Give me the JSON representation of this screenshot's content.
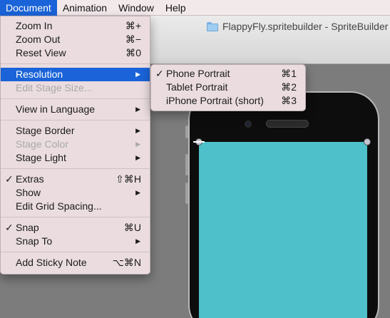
{
  "menubar": {
    "items": [
      "Document",
      "Animation",
      "Window",
      "Help"
    ]
  },
  "window": {
    "title": "FlappyFly.spritebuilder - SpriteBuilder"
  },
  "colors": {
    "highlight": "#1a63d8",
    "menu_bg": "#eadcdf",
    "stage_bg": "#7c7c7c",
    "phone_screen": "#4ec0ca"
  },
  "document_menu": {
    "zoom_in": {
      "label": "Zoom In",
      "shortcut": "⌘+"
    },
    "zoom_out": {
      "label": "Zoom Out",
      "shortcut": "⌘−"
    },
    "reset_view": {
      "label": "Reset View",
      "shortcut": "⌘0"
    },
    "resolution": {
      "label": "Resolution"
    },
    "edit_stage_size": {
      "label": "Edit Stage Size..."
    },
    "view_in_language": {
      "label": "View in Language"
    },
    "stage_border": {
      "label": "Stage Border"
    },
    "stage_color": {
      "label": "Stage Color"
    },
    "stage_light": {
      "label": "Stage Light"
    },
    "extras": {
      "label": "Extras",
      "shortcut": "⇧⌘H",
      "check": "✓"
    },
    "show": {
      "label": "Show"
    },
    "edit_grid_spacing": {
      "label": "Edit Grid Spacing..."
    },
    "snap": {
      "label": "Snap",
      "shortcut": "⌘U",
      "check": "✓"
    },
    "snap_to": {
      "label": "Snap To"
    },
    "add_sticky_note": {
      "label": "Add Sticky Note",
      "shortcut": "⌥⌘N"
    }
  },
  "resolution_menu": {
    "phone_portrait": {
      "label": "Phone Portrait",
      "shortcut": "⌘1",
      "check": "✓"
    },
    "tablet_portrait": {
      "label": "Tablet Portrait",
      "shortcut": "⌘2"
    },
    "iphone_portrait_short": {
      "label": "iPhone Portrait (short)",
      "shortcut": "⌘3"
    }
  },
  "icons": {
    "submenu_arrow": "▶",
    "folder": "folder-icon"
  }
}
